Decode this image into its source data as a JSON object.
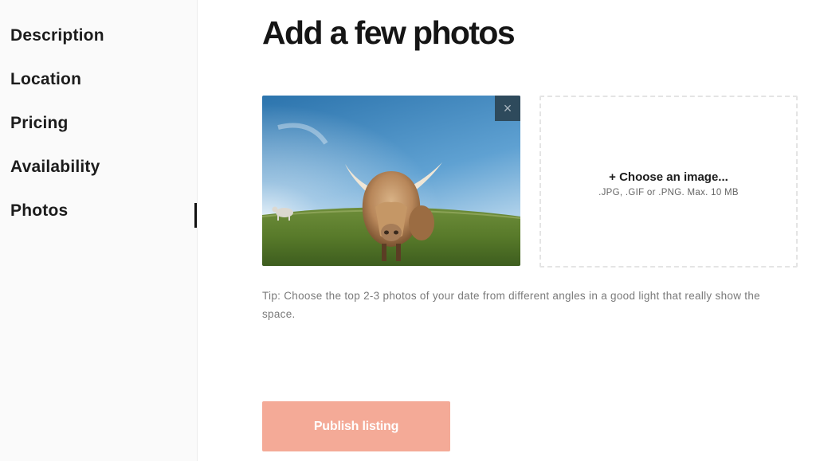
{
  "sidebar": {
    "items": [
      {
        "label": "Description"
      },
      {
        "label": "Location"
      },
      {
        "label": "Pricing"
      },
      {
        "label": "Availability"
      },
      {
        "label": "Photos",
        "active": true
      }
    ]
  },
  "main": {
    "title": "Add a few photos",
    "photo": {
      "subject": "highland-cow-photo",
      "remove_label": "×"
    },
    "upload": {
      "label": "+ Choose an image...",
      "hint": ".JPG, .GIF or .PNG. Max. 10 MB"
    },
    "tip": "Tip: Choose the top 2-3 photos of your date from different angles in a good light that really show the space.",
    "publish_label": "Publish listing"
  },
  "colors": {
    "publish_button": "#f4aa97",
    "remove_button": "#2e4a5c",
    "active_indicator": "#111111"
  }
}
